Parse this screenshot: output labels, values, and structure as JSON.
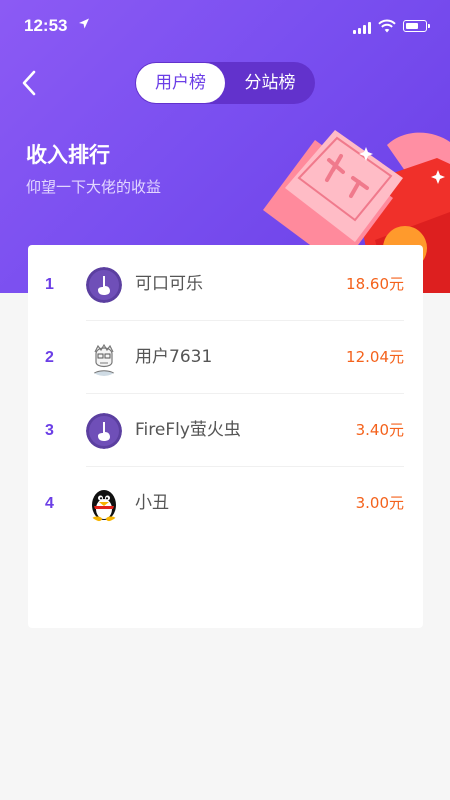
{
  "status_bar": {
    "time": "12:53"
  },
  "tabs": [
    {
      "label": "用户榜"
    },
    {
      "label": "分站榜"
    }
  ],
  "header": {
    "title": "收入排行",
    "subtitle": "仰望一下大佬的收益"
  },
  "ranking": [
    {
      "rank": "1",
      "name": "可口可乐",
      "amount": "18.60元",
      "avatar": "purple-finger-avatar"
    },
    {
      "rank": "2",
      "name": "用户7631",
      "amount": "12.04元",
      "avatar": "sketch-face-avatar"
    },
    {
      "rank": "3",
      "name": "FireFly萤火虫",
      "amount": "3.40元",
      "avatar": "purple-finger-avatar"
    },
    {
      "rank": "4",
      "name": "小丑",
      "amount": "3.00元",
      "avatar": "penguin-avatar"
    }
  ],
  "colors": {
    "accent": "#6b3ee6",
    "amount": "#f4621c",
    "header_gradient": [
      "#8c5af4",
      "#6a3fe6"
    ]
  }
}
